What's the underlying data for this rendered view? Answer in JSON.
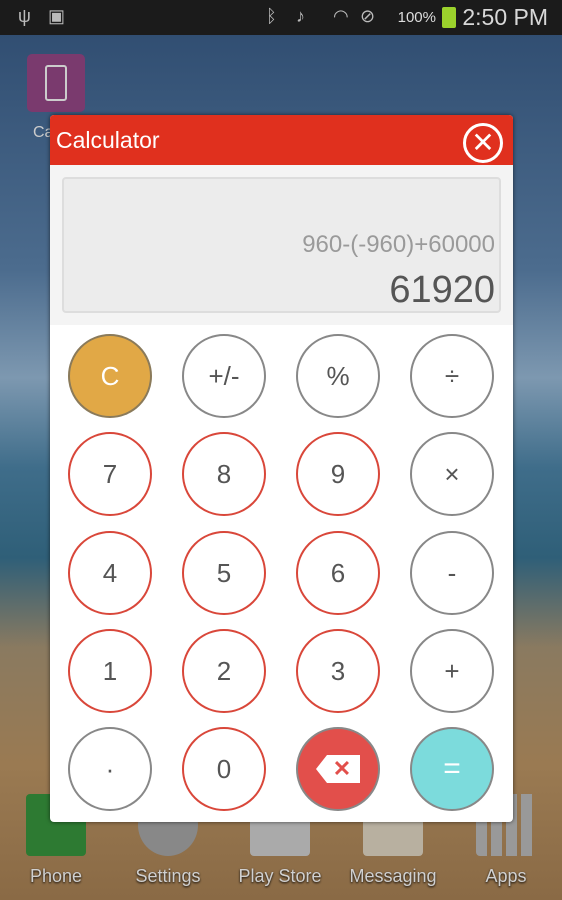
{
  "status_bar": {
    "battery": "100%",
    "time": "2:50 PM",
    "icons": [
      "usb-icon",
      "sd-card-icon",
      "bluetooth-icon",
      "mute-icon",
      "wifi-icon",
      "blocked-icon",
      "battery-charging-icon"
    ]
  },
  "home": {
    "shortcut_label": "Ca",
    "dock": [
      {
        "label": "Phone",
        "icon": "phone-icon"
      },
      {
        "label": "Settings",
        "icon": "gear-icon"
      },
      {
        "label": "Play Store",
        "icon": "play-store-icon"
      },
      {
        "label": "Messaging",
        "icon": "envelope-icon"
      },
      {
        "label": "Apps",
        "icon": "apps-grid-icon"
      }
    ]
  },
  "dialog": {
    "title": "Calculator",
    "close_glyph": "✕",
    "expression": "960-(-960)+60000",
    "result": "61920"
  },
  "keys": [
    {
      "label": "C",
      "type": "clear"
    },
    {
      "label": "+/-",
      "type": "op"
    },
    {
      "label": "%",
      "type": "op"
    },
    {
      "label": "÷",
      "type": "op"
    },
    {
      "label": "7",
      "type": "num"
    },
    {
      "label": "8",
      "type": "num"
    },
    {
      "label": "9",
      "type": "num"
    },
    {
      "label": "×",
      "type": "op"
    },
    {
      "label": "4",
      "type": "num"
    },
    {
      "label": "5",
      "type": "num"
    },
    {
      "label": "6",
      "type": "num"
    },
    {
      "label": "-",
      "type": "op"
    },
    {
      "label": "1",
      "type": "num"
    },
    {
      "label": "2",
      "type": "num"
    },
    {
      "label": "3",
      "type": "num"
    },
    {
      "label": "+",
      "type": "op"
    },
    {
      "label": "·",
      "type": "op"
    },
    {
      "label": "0",
      "type": "num"
    },
    {
      "label": "✕",
      "type": "back"
    },
    {
      "label": "=",
      "type": "eq"
    }
  ],
  "colors": {
    "title_bar": "#e0301e",
    "clear": "#e1a846",
    "backspace": "#e24f4b",
    "equals": "#7cdbdc",
    "num_border": "#d9473a"
  }
}
